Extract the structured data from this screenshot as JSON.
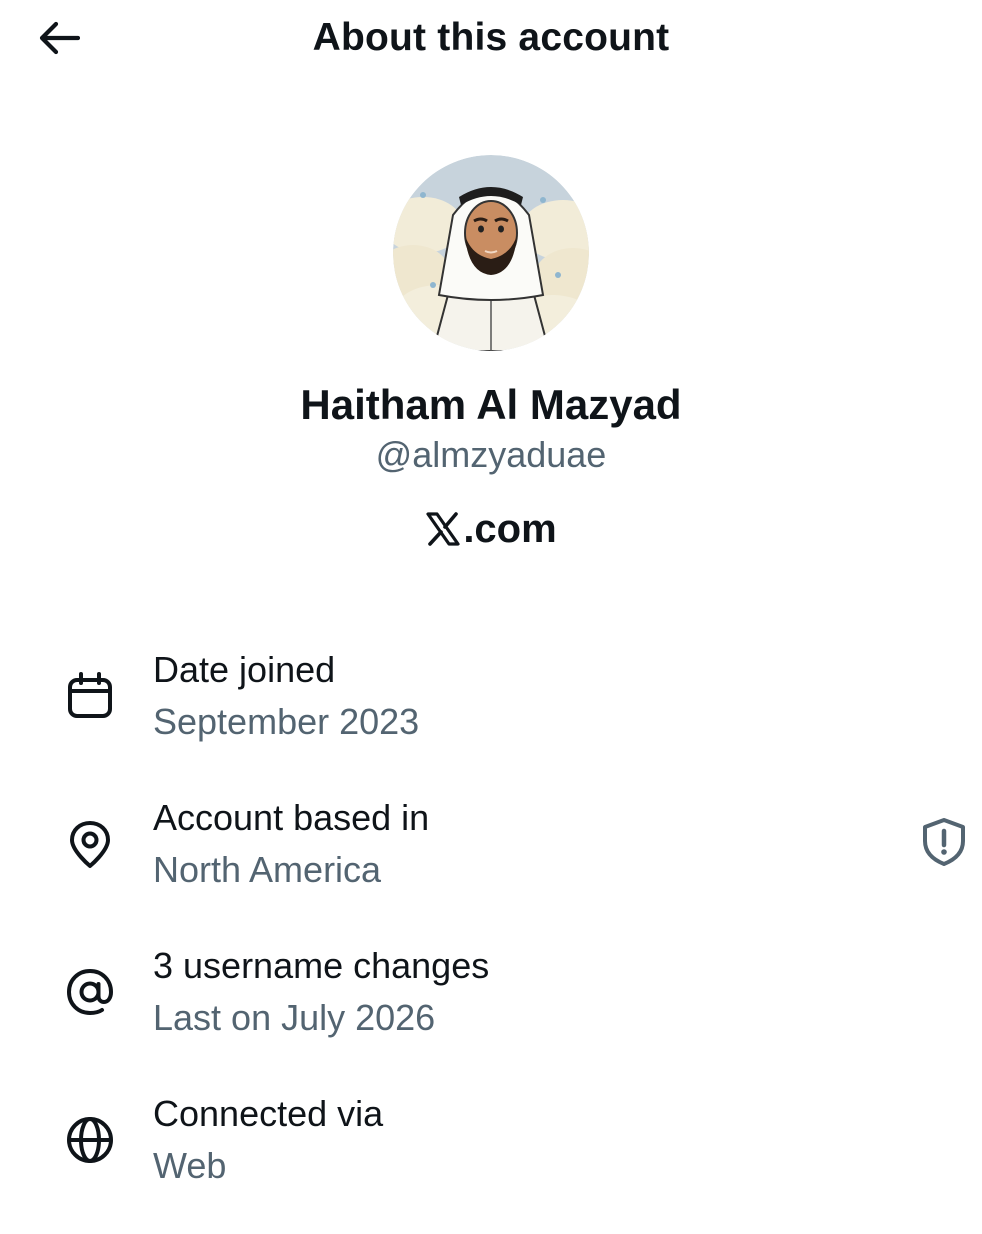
{
  "header": {
    "title": "About this account",
    "back_icon": "arrow-left-icon"
  },
  "profile": {
    "avatar_icon": "avatar",
    "display_name": "Haitham Al Mazyad",
    "handle": "@almzyaduae",
    "site": ".com",
    "site_logo": "x-logo-icon"
  },
  "info": {
    "items": [
      {
        "icon": "calendar-icon",
        "label": "Date joined",
        "value": "September 2023"
      },
      {
        "icon": "location-pin-icon",
        "label": "Account based in",
        "value": "North America",
        "action_icon": "shield-alert-icon"
      },
      {
        "icon": "at-sign-icon",
        "label": "3 username changes",
        "value": "Last on July 2026"
      },
      {
        "icon": "globe-icon",
        "label": "Connected via",
        "value": "Web"
      }
    ]
  },
  "colors": {
    "primary_text": "#0f1419",
    "secondary_text": "#536471",
    "background": "#ffffff"
  }
}
